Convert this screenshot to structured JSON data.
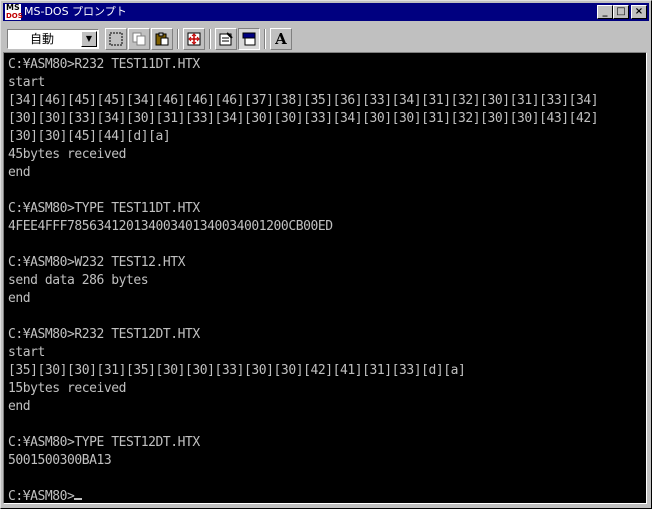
{
  "window": {
    "title": "MS-DOS プロンプト",
    "icon_label_top": "MS",
    "icon_label_bottom": "DOS",
    "controls": {
      "minimize": "_",
      "maximize": "□",
      "close": "×"
    }
  },
  "toolbar": {
    "font_size_value": "自動",
    "buttons": [
      {
        "name": "mark-icon"
      },
      {
        "name": "copy-icon"
      },
      {
        "name": "paste-icon"
      },
      {
        "name": "full-screen-icon"
      },
      {
        "name": "properties-icon"
      },
      {
        "name": "background-icon"
      },
      {
        "name": "font-icon",
        "label": "A"
      }
    ]
  },
  "console": {
    "lines": [
      "C:¥ASM80>R232 TEST11DT.HTX",
      "start",
      "[34][46][45][45][34][46][46][46][37][38][35][36][33][34][31][32][30][31][33][34]",
      "[30][30][33][34][30][31][33][34][30][30][33][34][30][30][31][32][30][30][43][42]",
      "[30][30][45][44][d][a]",
      "45bytes received",
      "end",
      "",
      "C:¥ASM80>TYPE TEST11DT.HTX",
      "4FEE4FFF785634120134003401340034001200CB00ED",
      "",
      "C:¥ASM80>W232 TEST12.HTX",
      "send data 286 bytes",
      "end",
      "",
      "C:¥ASM80>R232 TEST12DT.HTX",
      "start",
      "[35][30][30][31][35][30][30][33][30][30][42][41][31][33][d][a]",
      "15bytes received",
      "end",
      "",
      "C:¥ASM80>TYPE TEST12DT.HTX",
      "5001500300BA13",
      "",
      "C:¥ASM80>"
    ]
  },
  "colors": {
    "titlebar": "#000080",
    "console_bg": "#000000",
    "console_text": "#c0c0c0",
    "chrome": "#c0c0c0"
  }
}
